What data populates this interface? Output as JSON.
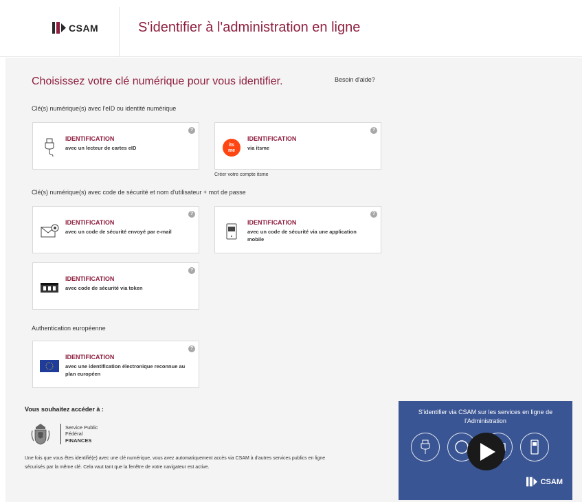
{
  "header": {
    "logo_text": "CSAM",
    "title": "S'identifier à l'administration en ligne"
  },
  "main": {
    "choose_title": "Choisissez votre clé numérique pour vous identifier.",
    "help_link": "Besoin d'aide?",
    "section_eid": "Clé(s) numérique(s) avec l'eID ou identité numérique",
    "section_code": "Clé(s) numérique(s) avec code de sécurité et nom d'utilisateur + mot de passe",
    "section_eu": "Authentication européenne",
    "help_symbol": "?",
    "cards": [
      {
        "title": "IDENTIFICATION",
        "desc": "avec un lecteur de cartes eID",
        "icon": "card-reader-icon"
      },
      {
        "title": "IDENTIFICATION",
        "desc": "via itsme",
        "icon": "itsme-logo-icon",
        "icon_text": "its me"
      },
      {
        "title": "IDENTIFICATION",
        "desc": "avec un code de sécurité envoyé par e-mail",
        "icon": "email-icon"
      },
      {
        "title": "IDENTIFICATION",
        "desc": "avec un code de sécurité via une application mobile",
        "icon": "mobile-app-icon"
      },
      {
        "title": "IDENTIFICATION",
        "desc": "avec code de sécurité via token",
        "icon": "token-icon"
      },
      {
        "title": "IDENTIFICATION",
        "desc": "avec une identification électronique reconnue au plan européen",
        "icon": "eu-flag-icon"
      }
    ],
    "create_itsme": "Créer votre compte itsme"
  },
  "access": {
    "title": "Vous souhaitez accéder à :",
    "finances_line1": "Service Public",
    "finances_line2": "Fédéral",
    "finances_line3": "FINANCES",
    "info": "Une fois que vous êtes identifié(e) avec une clé numérique, vous avez automatiquement accès via CSAM à d'autres services publics en ligne sécurisés par la même clé. Cela vaut tant que la fenêtre de votre navigateur est active."
  },
  "video": {
    "title": "S'identifier via CSAM sur les services en ligne de l'Administration",
    "logo_text": "CSAM"
  },
  "colors": {
    "brand": "#8e1f3f",
    "video_bg": "#3a5594",
    "itsme": "#ff4612"
  }
}
